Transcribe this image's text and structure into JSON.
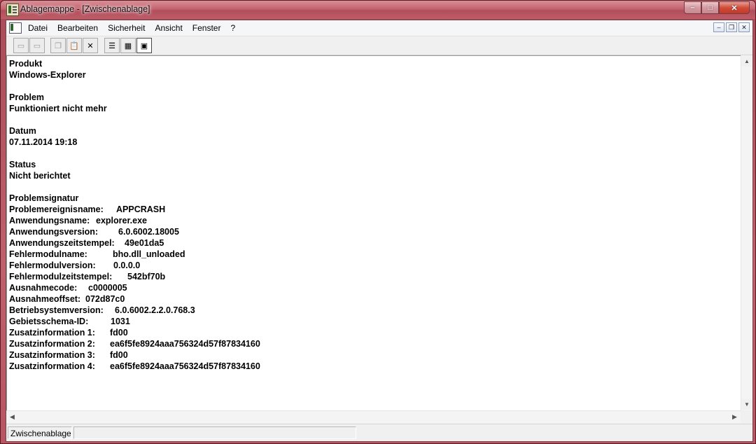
{
  "window": {
    "title": "Ablagemappe - [Zwischenablage]",
    "min": "–",
    "max": "□",
    "close": "✕"
  },
  "menu": {
    "items": [
      "Datei",
      "Bearbeiten",
      "Sicherheit",
      "Ansicht",
      "Fenster",
      "?"
    ],
    "mdi_min": "–",
    "mdi_restore": "❐",
    "mdi_close": "✕"
  },
  "toolbar": {
    "buttons": [
      {
        "name": "connect-icon",
        "glyph": "▭",
        "state": "disabled"
      },
      {
        "name": "disconnect-icon",
        "glyph": "▭",
        "state": "disabled"
      },
      {
        "name": "copy-icon",
        "glyph": "❐",
        "state": "disabled"
      },
      {
        "name": "paste-icon",
        "glyph": "📋",
        "state": "disabled"
      },
      {
        "name": "delete-icon",
        "glyph": "✕",
        "state": "enabled"
      },
      {
        "name": "list-view-icon",
        "glyph": "☰",
        "state": "enabled"
      },
      {
        "name": "table-view-icon",
        "glyph": "▦",
        "state": "enabled"
      },
      {
        "name": "full-page-view-icon",
        "glyph": "▣",
        "state": "active"
      }
    ]
  },
  "content": {
    "lines": [
      {
        "k": "Produkt",
        "v": ""
      },
      {
        "k": "Windows-Explorer",
        "v": ""
      },
      {
        "k": "",
        "v": ""
      },
      {
        "k": "Problem",
        "v": ""
      },
      {
        "k": "Funktioniert nicht mehr",
        "v": ""
      },
      {
        "k": "",
        "v": ""
      },
      {
        "k": "Datum",
        "v": ""
      },
      {
        "k": "07.11.2014 19:18",
        "v": ""
      },
      {
        "k": "",
        "v": ""
      },
      {
        "k": "Status",
        "v": ""
      },
      {
        "k": "Nicht berichtet",
        "v": ""
      },
      {
        "k": "",
        "v": ""
      },
      {
        "k": "Problemsignatur",
        "v": ""
      },
      {
        "k": "Problemereignisname:",
        "v": "APPCRASH"
      },
      {
        "k": "Anwendungsname:",
        "v": "explorer.exe"
      },
      {
        "k": "Anwendungsversion:",
        "v": "6.0.6002.18005"
      },
      {
        "k": "Anwendungszeitstempel:",
        "v": "49e01da5"
      },
      {
        "k": "Fehlermodulname:",
        "v": "bho.dll_unloaded"
      },
      {
        "k": "Fehlermodulversion:",
        "v": "0.0.0.0"
      },
      {
        "k": "Fehlermodulzeitstempel:",
        "v": "542bf70b"
      },
      {
        "k": "Ausnahmecode:",
        "v": "c0000005"
      },
      {
        "k": "Ausnahmeoffset:",
        "v": "072d87c0"
      },
      {
        "k": "Betriebsystemversion:",
        "v": "6.0.6002.2.2.0.768.3"
      },
      {
        "k": "Gebietsschema-ID:",
        "v": "1031"
      },
      {
        "k": "Zusatzinformation 1:",
        "v": "fd00"
      },
      {
        "k": "Zusatzinformation 2:",
        "v": "ea6f5fe8924aaa756324d57f87834160"
      },
      {
        "k": "Zusatzinformation 3:",
        "v": "fd00"
      },
      {
        "k": "Zusatzinformation 4:",
        "v": "ea6f5fe8924aaa756324d57f87834160"
      }
    ]
  },
  "status": {
    "pane1": "Zwischenablage",
    "pane2": "",
    "pane3": ""
  }
}
